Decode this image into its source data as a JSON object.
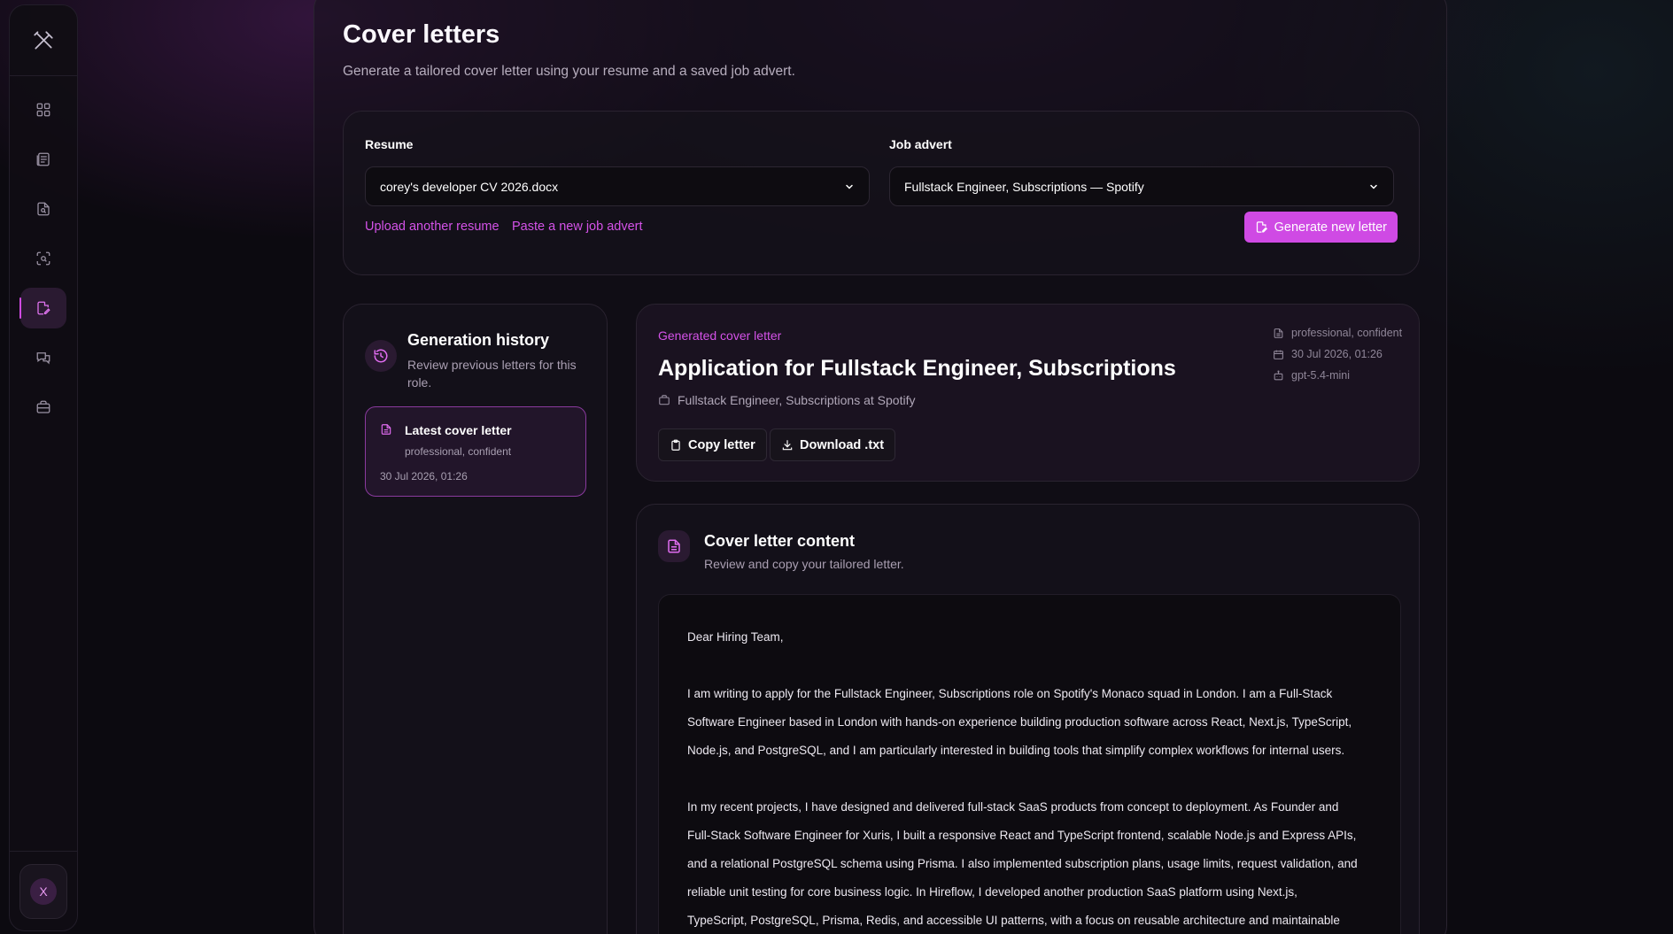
{
  "sidebar": {
    "logo_icon": "crossed-tools-icon",
    "items": [
      {
        "icon": "dashboard-icon",
        "active": false
      },
      {
        "icon": "resumes-icon",
        "active": false
      },
      {
        "icon": "resume-search-icon",
        "active": false
      },
      {
        "icon": "scan-icon",
        "active": false
      },
      {
        "icon": "cover-letter-icon",
        "active": true
      },
      {
        "icon": "chat-icon",
        "active": false
      },
      {
        "icon": "briefcase-icon",
        "active": false
      }
    ],
    "avatar_initial": "X"
  },
  "page": {
    "title": "Cover letters",
    "subtitle": "Generate a tailored cover letter using your resume and a saved job advert."
  },
  "selectors": {
    "resume_label": "Resume",
    "resume_value": "corey's developer CV 2026.docx",
    "job_label": "Job advert",
    "job_value": "Fullstack Engineer, Subscriptions — Spotify",
    "upload_link": "Upload another resume",
    "paste_link": "Paste a new job advert",
    "generate_button": "Generate new letter"
  },
  "history": {
    "title": "Generation history",
    "subtitle_line1": "Review previous letters for this",
    "subtitle_line2": "role.",
    "items": [
      {
        "title": "Latest cover letter",
        "tone": "professional, confident",
        "date": "30 Jul 2026, 01:26"
      }
    ]
  },
  "generated": {
    "label": "Generated cover letter",
    "title": "Application for Fullstack Engineer, Subscriptions",
    "role_line": "Fullstack Engineer, Subscriptions at Spotify",
    "meta_tone": "professional, confident",
    "meta_date": "30 Jul 2026, 01:26",
    "meta_model": "gpt-5.4-mini",
    "copy_button": "Copy letter",
    "download_button": "Download .txt"
  },
  "content": {
    "title": "Cover letter content",
    "subtitle": "Review and copy your tailored letter.",
    "greeting": "Dear Hiring Team,",
    "p1_lines": [
      "I am writing to apply for the Fullstack Engineer, Subscriptions role on Spotify's Monaco squad in London. I am a Full-Stack",
      "Software Engineer based in London with hands-on experience building production software across React, Next.js, TypeScript,",
      "Node.js, and PostgreSQL, and I am particularly interested in building tools that simplify complex workflows for internal users."
    ],
    "p2_lines": [
      "In my recent projects, I have designed and delivered full-stack SaaS products from concept to deployment. As Founder and",
      "Full-Stack Software Engineer for Xuris, I built a responsive React and TypeScript frontend, scalable Node.js and Express APIs,",
      "and a relational PostgreSQL schema using Prisma. I also implemented subscription plans, usage limits, request validation, and",
      "reliable unit testing for core business logic. In Hireflow, I developed another production SaaS platform using Next.js,",
      "TypeScript, PostgreSQL, Prisma, Redis, and accessible UI patterns, with a focus on reusable architecture and maintainable"
    ]
  },
  "colors": {
    "accent": "#cf4ae4",
    "background": "#0c0a10"
  }
}
